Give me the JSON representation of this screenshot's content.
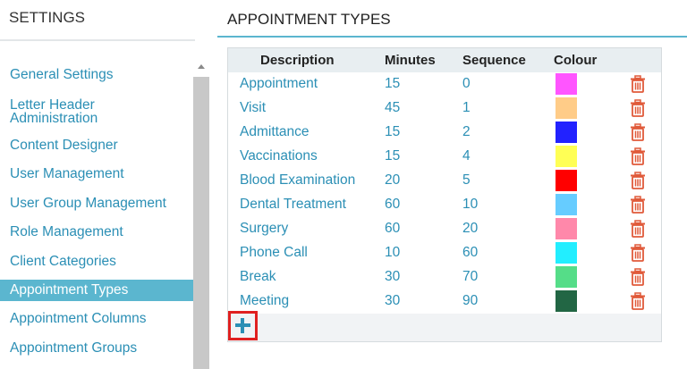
{
  "sidebar": {
    "title": "SETTINGS",
    "items": [
      {
        "label": "General Settings"
      },
      {
        "label": "Letter Header Administration"
      },
      {
        "label": "Content Designer"
      },
      {
        "label": "User Management"
      },
      {
        "label": "User Group Management"
      },
      {
        "label": "Role Management"
      },
      {
        "label": "Client Categories"
      },
      {
        "label": "Appointment Types",
        "active": true
      },
      {
        "label": "Appointment Columns"
      },
      {
        "label": "Appointment Groups"
      }
    ]
  },
  "main": {
    "title": "APPOINTMENT TYPES",
    "columns": {
      "description": "Description",
      "minutes": "Minutes",
      "sequence": "Sequence",
      "colour": "Colour"
    },
    "rows": [
      {
        "description": "Appointment",
        "minutes": "15",
        "sequence": "0",
        "colour": "#ff55ff"
      },
      {
        "description": "Visit",
        "minutes": "45",
        "sequence": "1",
        "colour": "#ffcc88"
      },
      {
        "description": "Admittance",
        "minutes": "15",
        "sequence": "2",
        "colour": "#2222ff"
      },
      {
        "description": "Vaccinations",
        "minutes": "15",
        "sequence": "4",
        "colour": "#ffff55"
      },
      {
        "description": "Blood Examination",
        "minutes": "20",
        "sequence": "5",
        "colour": "#ff0000"
      },
      {
        "description": "Dental Treatment",
        "minutes": "60",
        "sequence": "10",
        "colour": "#66ccff"
      },
      {
        "description": "Surgery",
        "minutes": "60",
        "sequence": "20",
        "colour": "#ff88aa"
      },
      {
        "description": "Phone Call",
        "minutes": "10",
        "sequence": "60",
        "colour": "#22eeff"
      },
      {
        "description": "Break",
        "minutes": "30",
        "sequence": "70",
        "colour": "#55dd88"
      },
      {
        "description": "Meeting",
        "minutes": "30",
        "sequence": "90",
        "colour": "#226644"
      }
    ]
  },
  "icons": {
    "delete": "trash-icon",
    "add": "plus-icon",
    "scroll_up": "arrow-up-icon"
  },
  "colors": {
    "accent": "#5bb6cf",
    "link": "#2b8fb5",
    "delete_icon": "#e05a3a",
    "highlight_border": "#e02020"
  }
}
